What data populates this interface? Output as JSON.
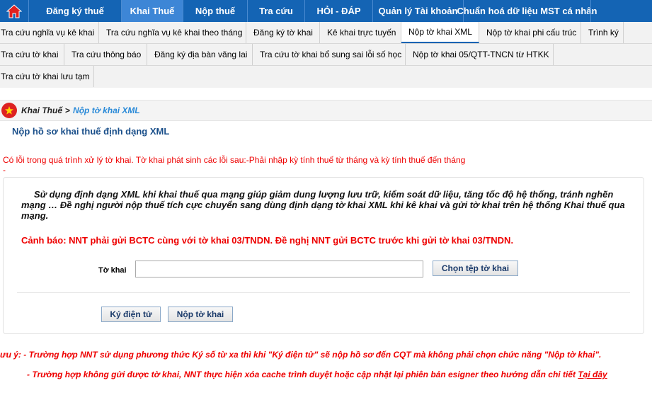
{
  "topnav": {
    "items": [
      {
        "label": "Đăng ký thuế"
      },
      {
        "label": "Khai Thuế"
      },
      {
        "label": "Nộp thuế"
      },
      {
        "label": "Tra cứu"
      },
      {
        "label": "HỎI - ĐÁP"
      },
      {
        "label": "Quản lý Tài khoản"
      },
      {
        "label": "Chuẩn hoá dữ liệu MST cá nhân"
      }
    ],
    "active_index": 1
  },
  "subnav": {
    "row1": [
      {
        "label": "Tra cứu nghĩa vụ kê khai"
      },
      {
        "label": "Tra cứu nghĩa vụ kê khai theo tháng"
      },
      {
        "label": "Đăng ký tờ khai"
      },
      {
        "label": "Kê khai trực tuyến"
      },
      {
        "label": "Nộp tờ khai XML"
      },
      {
        "label": "Nộp tờ khai phi cấu trúc"
      },
      {
        "label": "Trình ký"
      }
    ],
    "row2": [
      {
        "label": "Tra cứu tờ khai"
      },
      {
        "label": "Tra cứu thông báo"
      },
      {
        "label": "Đăng ký địa bàn vãng lai"
      },
      {
        "label": "Tra cứu tờ khai bổ sung sai lỗi số học"
      },
      {
        "label": "Nộp tờ khai 05/QTT-TNCN từ HTKK"
      }
    ],
    "row3": [
      {
        "label": "Tra cứu tờ khai lưu tạm"
      }
    ]
  },
  "breadcrumb": {
    "parent": "Khai Thuế",
    "separator": ">",
    "current": "Nộp tờ khai XML"
  },
  "page_title": "Nộp hồ sơ khai thuế định dạng XML",
  "error_message": "Có lỗi trong quá trình xử lý tờ khai. Tờ khai phát sinh các lỗi sau:-Phải nhập kỳ tính thuế từ tháng và kỳ tính thuế đến tháng",
  "error_dash": "-",
  "intro_text": "Sử dụng định dạng XML khi khai thuế qua mạng giúp giảm dung lượng lưu trữ, kiểm soát dữ liệu, tăng tốc độ hệ thống, tránh nghẽn mạng … Đề nghị người nộp thuế tích cực chuyển sang dùng định dạng tờ khai XML khi kê khai và gửi tờ khai trên hệ thống Khai thuế qua mạng.",
  "warning_text": "Cảnh báo: NNT phải gửi BCTC cùng với tờ khai 03/TNDN. Đề nghị NNT gửi BCTC trước khi gửi tờ khai 03/TNDN.",
  "form": {
    "file_label": "Tờ khai",
    "file_value": "",
    "choose_button": "Chọn tệp tờ khai",
    "sign_button": "Ký điện tử",
    "submit_button": "Nộp tờ khai"
  },
  "notes": {
    "note1": "ưu ý:   - Trường hợp NNT sử dụng phương thức Ký số từ xa thì khi \"Ký điện tử\" sẽ nộp hồ sơ đến CQT mà không phải chọn chức năng \"Nộp tờ khai\".",
    "note2_text": "- Trường hợp không gửi được tờ khai, NNT thực hiện xóa cache trình duyệt hoặc cập nhật lại phiên bản esigner theo hướng dẫn chi tiết ",
    "note2_link": "Tại đây"
  },
  "colors": {
    "nav_bg": "#1464b4",
    "nav_active": "#3d86d6",
    "error": "#e00000",
    "title": "#1a4f8a"
  }
}
